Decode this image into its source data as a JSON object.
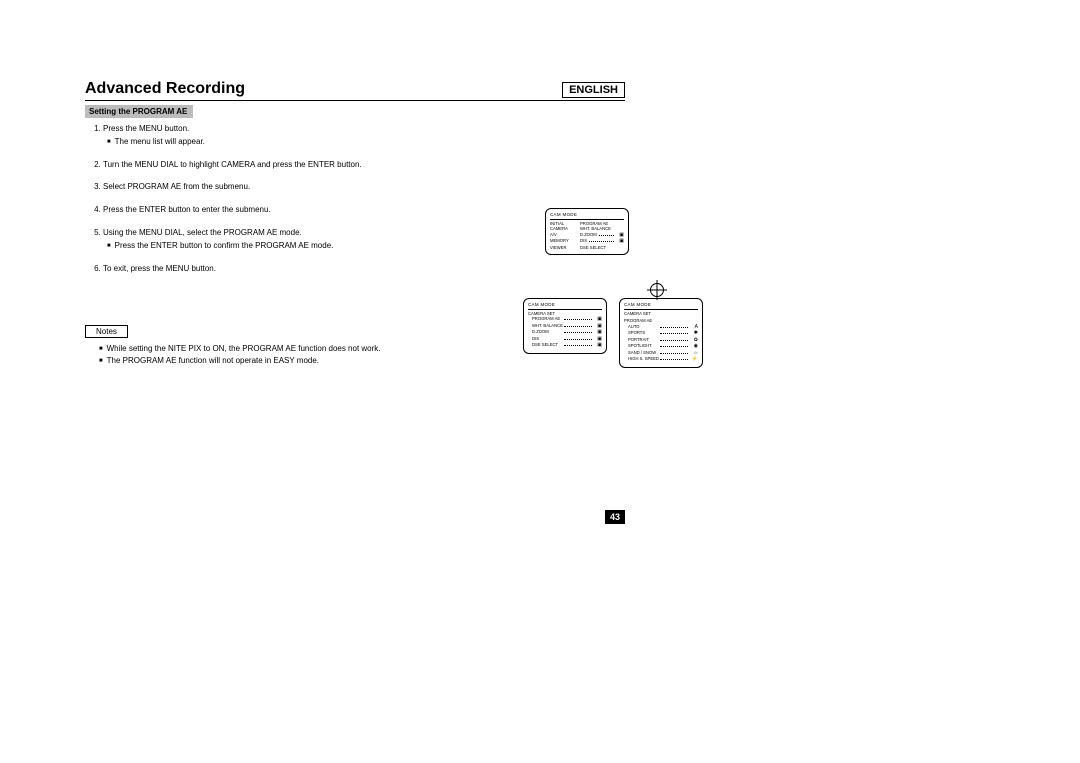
{
  "header": {
    "title": "Advanced Recording",
    "language": "ENGLISH"
  },
  "section": {
    "subtitle": "Setting the PROGRAM AE"
  },
  "steps": {
    "s1": "Press the MENU button.",
    "s1a": "The menu list will appear.",
    "s2": "Turn the MENU DIAL to highlight CAMERA and press the ENTER button.",
    "s3": "Select PROGRAM AE from the submenu.",
    "s4": "Press the ENTER button to enter the submenu.",
    "s5": "Using the MENU DIAL, select the PROGRAM AE mode.",
    "s5a": "Press the ENTER button to confirm the PROGRAM AE mode.",
    "s6": "To exit, press the MENU button."
  },
  "notes": {
    "label": "Notes",
    "n1": "While setting the NITE PIX to ON, the PROGRAM AE function does not work.",
    "n2": "The PROGRAM AE function will not operate in EASY mode."
  },
  "page_number": "43",
  "menus": {
    "screen_title": "CAM MODE",
    "p1": {
      "left": [
        "INITIAL",
        "CAMERA",
        "A/V",
        "MEMORY",
        "VIEWER"
      ],
      "right": [
        "PROGRAM AE",
        "WHT. BALANCE",
        "D.ZOOM",
        "DIS",
        "DSE SELECT"
      ]
    },
    "p2": {
      "heading": "CAMERA SET",
      "items": [
        "PROGRAM AE",
        "WHT. BALANCE",
        "D.ZOOM",
        "DIS",
        "DSE SELECT"
      ]
    },
    "p3": {
      "heading": "CAMERA SET",
      "sub": "PROGRAM AE",
      "items": [
        "AUTO",
        "SPORTS",
        "PORTRAIT",
        "SPOTLIGHT",
        "SAND / SNOW",
        "HIGH S. SPEED"
      ],
      "icons": [
        "A",
        "✱",
        "✿",
        "◉",
        "☼",
        "⚡"
      ]
    }
  }
}
